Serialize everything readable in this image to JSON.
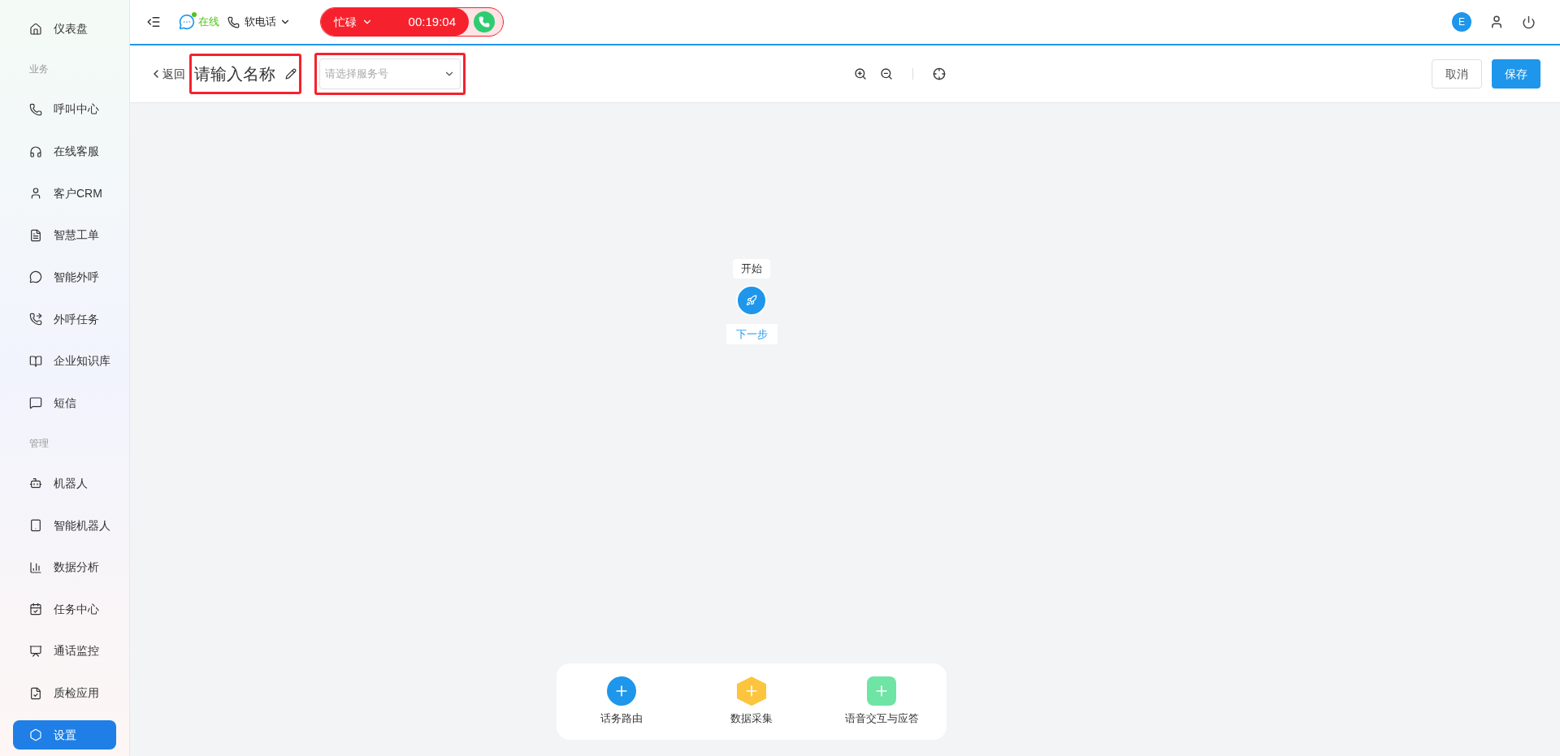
{
  "sidebar": {
    "items": [
      {
        "kind": "item",
        "label": "仪表盘",
        "selected": false
      },
      {
        "kind": "section",
        "label": "业务"
      },
      {
        "kind": "item",
        "label": "呼叫中心",
        "selected": false
      },
      {
        "kind": "item",
        "label": "在线客服",
        "selected": false
      },
      {
        "kind": "item",
        "label": "客户CRM",
        "selected": false
      },
      {
        "kind": "item",
        "label": "智慧工单",
        "selected": false
      },
      {
        "kind": "item",
        "label": "智能外呼",
        "selected": false
      },
      {
        "kind": "item",
        "label": "外呼任务",
        "selected": false
      },
      {
        "kind": "item",
        "label": "企业知识库",
        "selected": false
      },
      {
        "kind": "item",
        "label": "短信",
        "selected": false
      },
      {
        "kind": "section",
        "label": "管理"
      },
      {
        "kind": "item",
        "label": "机器人",
        "selected": false
      },
      {
        "kind": "item",
        "label": "智能机器人",
        "selected": false
      },
      {
        "kind": "item",
        "label": "数据分析",
        "selected": false
      },
      {
        "kind": "item",
        "label": "任务中心",
        "selected": false
      },
      {
        "kind": "item",
        "label": "通话监控",
        "selected": false
      },
      {
        "kind": "item",
        "label": "质检应用",
        "selected": false
      },
      {
        "kind": "item",
        "label": "设置",
        "selected": true
      }
    ]
  },
  "topbar": {
    "presence": "在线",
    "online": true,
    "phone_mode": "软电话",
    "status": "忙碌",
    "timer": "00:19:04",
    "avatar": "E"
  },
  "editor": {
    "back": "返回",
    "name_placeholder": "请输入名称",
    "service_placeholder": "请选择服务号",
    "cancel": "取消",
    "save": "保存"
  },
  "canvas": {
    "start_label": "开始",
    "next_label": "下一步"
  },
  "palette": [
    {
      "kind": "circle",
      "label": "话务路由",
      "color": "#1e96eb"
    },
    {
      "kind": "hexagon",
      "label": "数据采集",
      "color": "#fdc43d"
    },
    {
      "kind": "square",
      "label": "语音交互与应答",
      "color": "#6ee4a5"
    }
  ]
}
